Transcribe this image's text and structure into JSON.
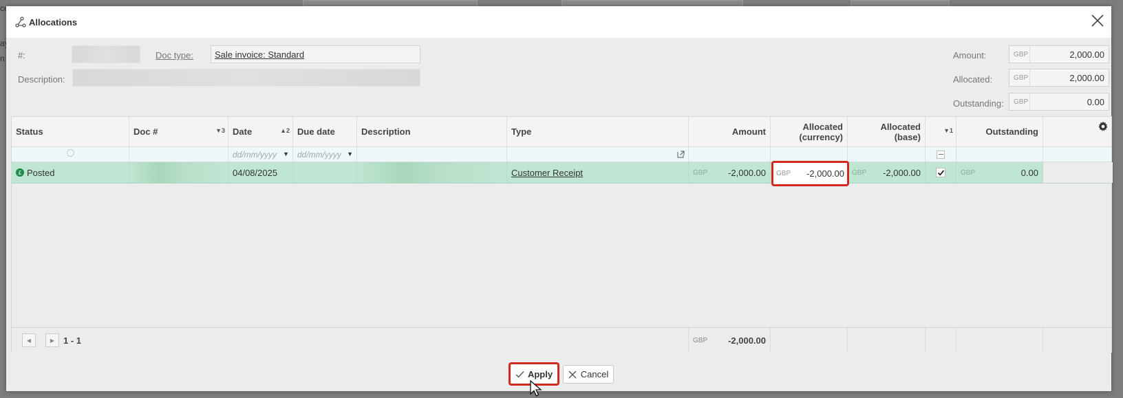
{
  "background": {
    "edge_texts": [
      "ce",
      "ay",
      "n"
    ]
  },
  "dialog": {
    "title": "Allocations"
  },
  "form": {
    "number_label": "#:",
    "doc_type_label": "Doc type:",
    "doc_type_value": "Sale invoice: Standard",
    "description_label": "Description:",
    "amount_label": "Amount:",
    "allocated_label": "Allocated:",
    "outstanding_label": "Outstanding:",
    "currency": "GBP",
    "amount_value": "2,000.00",
    "allocated_value": "2,000.00",
    "outstanding_value": "0.00"
  },
  "grid": {
    "headers": {
      "status": "Status",
      "doc_no": "Doc #",
      "doc_no_sort": "▼3",
      "date": "Date",
      "date_sort": "▲2",
      "due_date": "Due date",
      "description": "Description",
      "type": "Type",
      "amount": "Amount",
      "allocated_currency": "Allocated (currency)",
      "allocated_base": "Allocated (base)",
      "check_sort": "▼1",
      "outstanding": "Outstanding"
    },
    "filters": {
      "date_placeholder": "dd/mm/yyyy",
      "due_date_placeholder": "dd/mm/yyyy"
    },
    "row": {
      "status": "Posted",
      "date": "04/08/2025",
      "type": "Customer Receipt",
      "currency": "GBP",
      "amount": "-2,000.00",
      "allocated_currency": "-2,000.00",
      "allocated_base": "-2,000.00",
      "checked": true,
      "outstanding": "0.00"
    },
    "footer": {
      "range": "1 - 1",
      "currency": "GBP",
      "total": "-2,000.00"
    }
  },
  "buttons": {
    "apply": "Apply",
    "cancel": "Cancel"
  },
  "colors": {
    "highlight": "#d0281e",
    "row": "#bfe6d2",
    "status_posted": "#1d8a4e"
  }
}
